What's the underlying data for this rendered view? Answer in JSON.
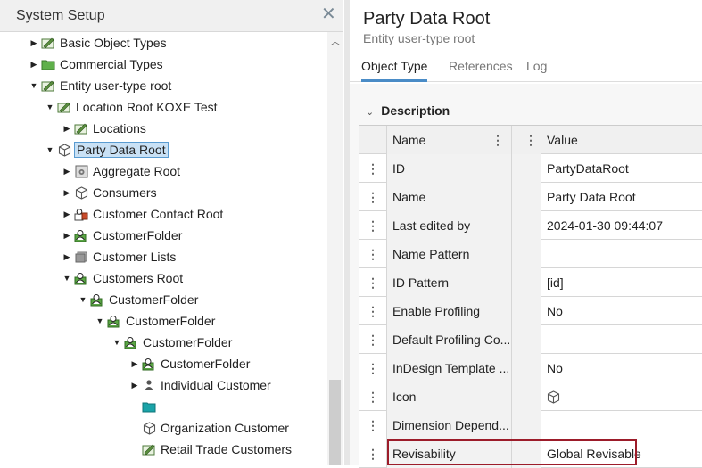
{
  "left_panel": {
    "title": "System Setup",
    "close_label": "✕",
    "tree": [
      {
        "label": "Basic Object Types",
        "icon": "edit-folder-icon",
        "arrow": "collapsed"
      },
      {
        "label": "Commercial Types",
        "icon": "green-folder-icon",
        "arrow": "collapsed"
      },
      {
        "label": "Entity user-type root",
        "icon": "edit-folder-icon",
        "arrow": "expanded"
      },
      {
        "label": "Location Root KOXE Test",
        "icon": "edit-folder-icon",
        "arrow": "expanded"
      },
      {
        "label": "Locations",
        "icon": "edit-folder-icon",
        "arrow": "collapsed"
      },
      {
        "label": "Party Data Root",
        "icon": "cube-icon",
        "arrow": "expanded",
        "selected": true
      },
      {
        "label": "Aggregate Root",
        "icon": "settings-box-icon",
        "arrow": "collapsed"
      },
      {
        "label": "Consumers",
        "icon": "cube-icon",
        "arrow": "collapsed"
      },
      {
        "label": "Customer Contact Root",
        "icon": "contact-red-icon",
        "arrow": "collapsed"
      },
      {
        "label": "CustomerFolder",
        "icon": "user-folder-icon",
        "arrow": "collapsed"
      },
      {
        "label": "Customer Lists",
        "icon": "list-icon",
        "arrow": "collapsed"
      },
      {
        "label": "Customers Root",
        "icon": "user-folder-icon",
        "arrow": "expanded"
      },
      {
        "label": "CustomerFolder",
        "icon": "user-folder-icon",
        "arrow": "expanded"
      },
      {
        "label": "CustomerFolder",
        "icon": "user-folder-icon",
        "arrow": "expanded"
      },
      {
        "label": "CustomerFolder",
        "icon": "user-folder-icon",
        "arrow": "expanded"
      },
      {
        "label": "CustomerFolder",
        "icon": "user-folder-icon",
        "arrow": "collapsed"
      },
      {
        "label": "Individual Customer",
        "icon": "person-icon",
        "arrow": "collapsed"
      },
      {
        "label": "",
        "icon": "teal-folder-icon",
        "arrow": "none"
      },
      {
        "label": "Organization Customer",
        "icon": "cube-icon",
        "arrow": "none"
      },
      {
        "label": "Retail Trade Customers",
        "icon": "edit-folder-icon",
        "arrow": "none"
      }
    ]
  },
  "right_panel": {
    "title": "Party Data Root",
    "subtitle": "Entity user-type root",
    "tabs": [
      "Object Type",
      "References",
      "Log"
    ],
    "active_tab": "Object Type",
    "section": "Description",
    "columns": {
      "name": "Name",
      "value": "Value"
    },
    "rows": [
      {
        "name": "ID",
        "value": "PartyDataRoot"
      },
      {
        "name": "Name",
        "value": "Party Data Root"
      },
      {
        "name": "Last edited by",
        "value": "2024-01-30 09:44:07"
      },
      {
        "name": "Name Pattern",
        "value": ""
      },
      {
        "name": "ID Pattern",
        "value": "[id]"
      },
      {
        "name": "Enable Profiling",
        "value": "No"
      },
      {
        "name": "Default Profiling Co...",
        "value": ""
      },
      {
        "name": "InDesign Template ...",
        "value": "No"
      },
      {
        "name": "Icon",
        "value": "",
        "value_icon": "cube-icon"
      },
      {
        "name": "Dimension Depend...",
        "value": ""
      },
      {
        "name": "Revisability",
        "value": "Global Revisable",
        "highlighted": true
      }
    ]
  },
  "colors": {
    "highlight_border": "#9c1c2a",
    "selection_bg": "#c9e1f5",
    "tab_underline": "#4a8cc7"
  }
}
